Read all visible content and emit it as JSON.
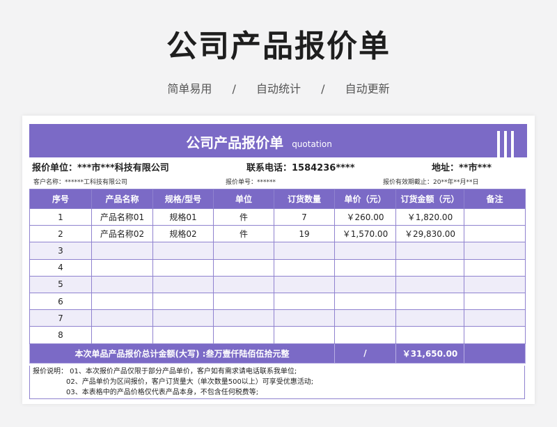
{
  "header": {
    "title": "公司产品报价单",
    "tags": [
      "简单易用",
      "自动统计",
      "自动更新"
    ],
    "separator": "/"
  },
  "banner": {
    "title": "公司产品报价单",
    "subtitle_en": "quotation"
  },
  "info": {
    "company": "报价单位：***市***科技有限公司",
    "phone": "联系电话：1584236****",
    "address": "地址：**市***",
    "customer": "客户名称：******工科技有限公司",
    "quote_no": "报价单号：******",
    "valid_until": "报价有效期截止：20**年**月**日"
  },
  "table": {
    "columns": [
      "序号",
      "产品名称",
      "规格/型号",
      "单位",
      "订货数量",
      "单价（元）",
      "订货金额（元）",
      "备注"
    ],
    "rows": [
      [
        "1",
        "产品名称01",
        "规格01",
        "件",
        "7",
        "￥260.00",
        "￥1,820.00",
        ""
      ],
      [
        "2",
        "产品名称02",
        "规格02",
        "件",
        "19",
        "￥1,570.00",
        "￥29,830.00",
        ""
      ],
      [
        "3",
        "",
        "",
        "",
        "",
        "",
        "",
        ""
      ],
      [
        "4",
        "",
        "",
        "",
        "",
        "",
        "",
        ""
      ],
      [
        "5",
        "",
        "",
        "",
        "",
        "",
        "",
        ""
      ],
      [
        "6",
        "",
        "",
        "",
        "",
        "",
        "",
        ""
      ],
      [
        "7",
        "",
        "",
        "",
        "",
        "",
        "",
        ""
      ],
      [
        "8",
        "",
        "",
        "",
        "",
        "",
        "",
        ""
      ]
    ],
    "total_label": "本次单品产品报价总计金额(大写) :叁万壹仟陆佰伍拾元整",
    "total_mid": "/",
    "total_amount": "￥31,650.00"
  },
  "notes": [
    "报价说明： 01、本次报价产品仅限于部分产品单价，客户如有需求请电话联系我单位;",
    "02、产品单价为区间报价，客户订货量大（单次数量500以上）可享受优惠活动;",
    "03、本表格中的产品价格仅代表产品本身，不包含任何税费等;"
  ],
  "colors": {
    "accent": "#7b6ac6",
    "row_alt": "#efedf9"
  }
}
